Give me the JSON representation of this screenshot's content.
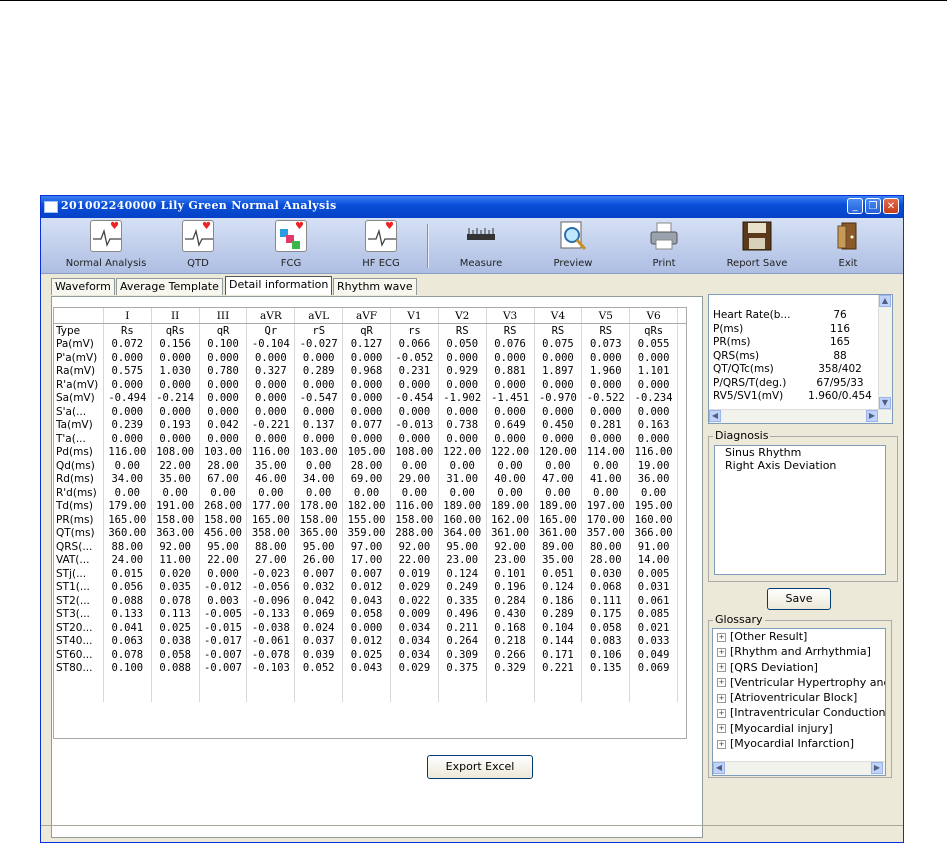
{
  "window": {
    "title": "201002240000  Lily Green  Normal Analysis"
  },
  "toolbar": {
    "normal_analysis": "Normal Analysis",
    "qtd": "QTD",
    "fcg": "FCG",
    "hf_ecg": "HF ECG",
    "measure": "Measure",
    "preview": "Preview",
    "print": "Print",
    "report_save": "Report Save",
    "exit": "Exit"
  },
  "tabs": [
    "Waveform",
    "Average Template",
    "Detail information",
    "Rhythm wave"
  ],
  "table": {
    "columns": [
      "",
      "I",
      "II",
      "III",
      "aVR",
      "aVL",
      "aVF",
      "V1",
      "V2",
      "V3",
      "V4",
      "V5",
      "V6"
    ],
    "rows": [
      [
        "Type",
        "Rs",
        "qRs",
        "qR",
        "Qr",
        "rS",
        "qR",
        "rs",
        "RS",
        "RS",
        "RS",
        "RS",
        "qRs"
      ],
      [
        "Pa(mV)",
        "0.072",
        "0.156",
        "0.100",
        "-0.104",
        "-0.027",
        "0.127",
        "0.066",
        "0.050",
        "0.076",
        "0.075",
        "0.073",
        "0.055"
      ],
      [
        "P'a(mV)",
        "0.000",
        "0.000",
        "0.000",
        "0.000",
        "0.000",
        "0.000",
        "-0.052",
        "0.000",
        "0.000",
        "0.000",
        "0.000",
        "0.000"
      ],
      [
        "Ra(mV)",
        "0.575",
        "1.030",
        "0.780",
        "0.327",
        "0.289",
        "0.968",
        "0.231",
        "0.929",
        "0.881",
        "1.897",
        "1.960",
        "1.101"
      ],
      [
        "R'a(mV)",
        "0.000",
        "0.000",
        "0.000",
        "0.000",
        "0.000",
        "0.000",
        "0.000",
        "0.000",
        "0.000",
        "0.000",
        "0.000",
        "0.000"
      ],
      [
        "Sa(mV)",
        "-0.494",
        "-0.214",
        "0.000",
        "0.000",
        "-0.547",
        "0.000",
        "-0.454",
        "-1.902",
        "-1.451",
        "-0.970",
        "-0.522",
        "-0.234"
      ],
      [
        "S'a(...",
        "0.000",
        "0.000",
        "0.000",
        "0.000",
        "0.000",
        "0.000",
        "0.000",
        "0.000",
        "0.000",
        "0.000",
        "0.000",
        "0.000"
      ],
      [
        "Ta(mV)",
        "0.239",
        "0.193",
        "0.042",
        "-0.221",
        "0.137",
        "0.077",
        "-0.013",
        "0.738",
        "0.649",
        "0.450",
        "0.281",
        "0.163"
      ],
      [
        "T'a(...",
        "0.000",
        "0.000",
        "0.000",
        "0.000",
        "0.000",
        "0.000",
        "0.000",
        "0.000",
        "0.000",
        "0.000",
        "0.000",
        "0.000"
      ],
      [
        "Pd(ms)",
        "116.00",
        "108.00",
        "103.00",
        "116.00",
        "103.00",
        "105.00",
        "108.00",
        "122.00",
        "122.00",
        "120.00",
        "114.00",
        "116.00"
      ],
      [
        "Qd(ms)",
        "0.00",
        "22.00",
        "28.00",
        "35.00",
        "0.00",
        "28.00",
        "0.00",
        "0.00",
        "0.00",
        "0.00",
        "0.00",
        "19.00"
      ],
      [
        "Rd(ms)",
        "34.00",
        "35.00",
        "67.00",
        "46.00",
        "34.00",
        "69.00",
        "29.00",
        "31.00",
        "40.00",
        "47.00",
        "41.00",
        "36.00"
      ],
      [
        "R'd(ms)",
        "0.00",
        "0.00",
        "0.00",
        "0.00",
        "0.00",
        "0.00",
        "0.00",
        "0.00",
        "0.00",
        "0.00",
        "0.00",
        "0.00"
      ],
      [
        "Td(ms)",
        "179.00",
        "191.00",
        "268.00",
        "177.00",
        "178.00",
        "182.00",
        "116.00",
        "189.00",
        "189.00",
        "189.00",
        "197.00",
        "195.00"
      ],
      [
        "PR(ms)",
        "165.00",
        "158.00",
        "158.00",
        "165.00",
        "158.00",
        "155.00",
        "158.00",
        "160.00",
        "162.00",
        "165.00",
        "170.00",
        "160.00"
      ],
      [
        "QT(ms)",
        "360.00",
        "363.00",
        "456.00",
        "358.00",
        "365.00",
        "359.00",
        "288.00",
        "364.00",
        "361.00",
        "361.00",
        "357.00",
        "366.00"
      ],
      [
        "QRS(...",
        "88.00",
        "92.00",
        "95.00",
        "88.00",
        "95.00",
        "97.00",
        "92.00",
        "95.00",
        "92.00",
        "89.00",
        "80.00",
        "91.00"
      ],
      [
        "VAT(...",
        "24.00",
        "11.00",
        "22.00",
        "27.00",
        "26.00",
        "17.00",
        "22.00",
        "23.00",
        "23.00",
        "35.00",
        "28.00",
        "14.00"
      ],
      [
        "STj(...",
        "0.015",
        "0.020",
        "0.000",
        "-0.023",
        "0.007",
        "0.007",
        "0.019",
        "0.124",
        "0.101",
        "0.051",
        "0.030",
        "0.005"
      ],
      [
        "ST1(...",
        "0.056",
        "0.035",
        "-0.012",
        "-0.056",
        "0.032",
        "0.012",
        "0.029",
        "0.249",
        "0.196",
        "0.124",
        "0.068",
        "0.031"
      ],
      [
        "ST2(...",
        "0.088",
        "0.078",
        "0.003",
        "-0.096",
        "0.042",
        "0.043",
        "0.022",
        "0.335",
        "0.284",
        "0.186",
        "0.111",
        "0.061"
      ],
      [
        "ST3(...",
        "0.133",
        "0.113",
        "-0.005",
        "-0.133",
        "0.069",
        "0.058",
        "0.009",
        "0.496",
        "0.430",
        "0.289",
        "0.175",
        "0.085"
      ],
      [
        "ST20...",
        "0.041",
        "0.025",
        "-0.015",
        "-0.038",
        "0.024",
        "0.000",
        "0.034",
        "0.211",
        "0.168",
        "0.104",
        "0.058",
        "0.021"
      ],
      [
        "ST40...",
        "0.063",
        "0.038",
        "-0.017",
        "-0.061",
        "0.037",
        "0.012",
        "0.034",
        "0.264",
        "0.218",
        "0.144",
        "0.083",
        "0.033"
      ],
      [
        "ST60...",
        "0.078",
        "0.058",
        "-0.007",
        "-0.078",
        "0.039",
        "0.025",
        "0.034",
        "0.309",
        "0.266",
        "0.171",
        "0.106",
        "0.049"
      ],
      [
        "ST80...",
        "0.100",
        "0.088",
        "-0.007",
        "-0.103",
        "0.052",
        "0.043",
        "0.029",
        "0.375",
        "0.329",
        "0.221",
        "0.135",
        "0.069"
      ]
    ]
  },
  "export_label": "Export Excel",
  "measurements": [
    [
      "Heart Rate(b...",
      "76"
    ],
    [
      "P(ms)",
      "116"
    ],
    [
      "PR(ms)",
      "165"
    ],
    [
      "QRS(ms)",
      "88"
    ],
    [
      "QT/QTc(ms)",
      "358/402"
    ],
    [
      "P/QRS/T(deg.)",
      "67/95/33"
    ],
    [
      "RV5/SV1(mV)",
      "1.960/0.454"
    ]
  ],
  "diagnosis": {
    "label": "Diagnosis",
    "items": [
      "Sinus Rhythm",
      "Right Axis Deviation"
    ]
  },
  "save_label": "Save",
  "glossary": {
    "label": "Glossary",
    "items": [
      "[Other Result]",
      "[Rhythm and Arrhythmia]",
      "[QRS Deviation]",
      "[Ventricular Hypertrophy and Atrial Enlargement]",
      "[Atrioventricular Block]",
      "[Intraventricular Conduction Block]",
      "[Myocardial injury]",
      "[Myocardial Infarction]"
    ]
  }
}
